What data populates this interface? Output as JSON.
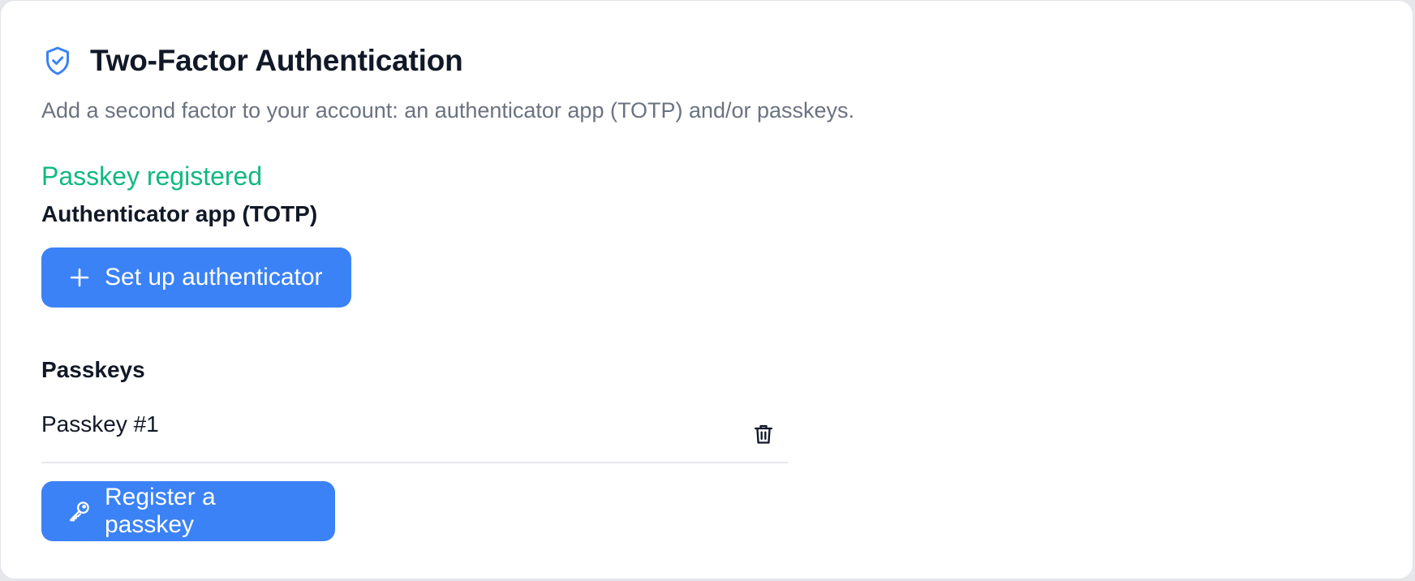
{
  "header": {
    "title": "Two-Factor Authentication",
    "subtitle": "Add a second factor to your account: an authenticator app (TOTP) and/or passkeys.",
    "icon": "shield-check-icon"
  },
  "status": {
    "message": "Passkey registered",
    "color": "#10b981"
  },
  "totp": {
    "heading": "Authenticator app (TOTP)",
    "setup_button_label": "Set up authenticator",
    "setup_button_icon": "plus-icon"
  },
  "passkeys": {
    "heading": "Passkeys",
    "items": [
      {
        "name": "Passkey #1",
        "action_icon": "trash-icon"
      }
    ],
    "register_button_label": "Register a passkey",
    "register_button_icon": "key-icon"
  },
  "colors": {
    "accent": "#3b82f6",
    "heading": "#111827",
    "muted": "#6b7280"
  }
}
